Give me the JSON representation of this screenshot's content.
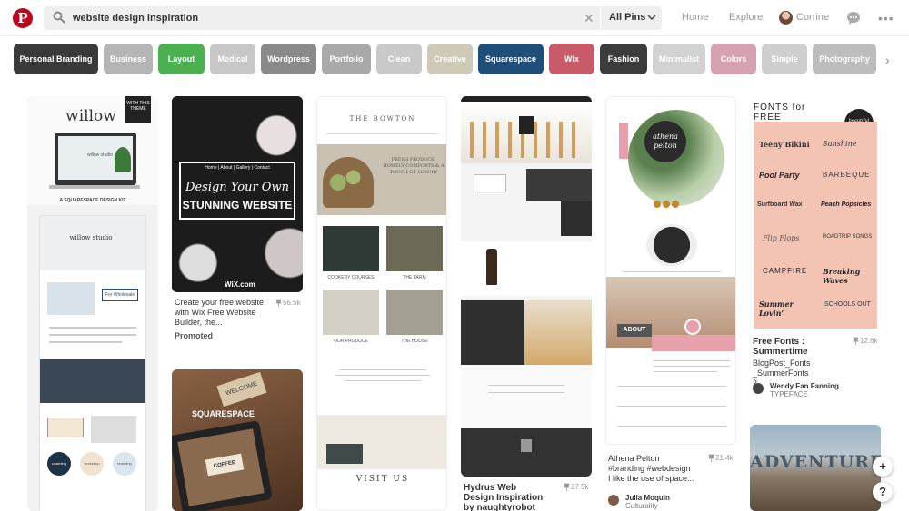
{
  "header": {
    "logo": "P",
    "search_value": "website design inspiration",
    "scope": "All Pins",
    "nav_home": "Home",
    "nav_explore": "Explore",
    "user_name": "Corrine"
  },
  "guides": [
    {
      "label": "Personal Branding",
      "color": "#3a3a3a"
    },
    {
      "label": "Business",
      "color": "#b5b5b5"
    },
    {
      "label": "Layout",
      "color": "#4caf50"
    },
    {
      "label": "Medical",
      "color": "#c7c7c7"
    },
    {
      "label": "Wordpress",
      "color": "#8a8a8a"
    },
    {
      "label": "Portfolio",
      "color": "#a9a9a9"
    },
    {
      "label": "Clean",
      "color": "#c9c9c9"
    },
    {
      "label": "Creative",
      "color": "#cfc9b8"
    },
    {
      "label": "Squarespace",
      "color": "#1f4e79"
    },
    {
      "label": "Wix",
      "color": "#c75b6a"
    },
    {
      "label": "Fashion",
      "color": "#3c3c3c"
    },
    {
      "label": "Minimalist",
      "color": "#d2d2d2"
    },
    {
      "label": "Colors",
      "color": "#d6a2b0"
    },
    {
      "label": "Simple",
      "color": "#cfcfcf"
    },
    {
      "label": "Photography",
      "color": "#bdbdbd"
    }
  ],
  "pins": {
    "willow": {
      "brand": "willow",
      "badge": "WITH THIS THEME",
      "studio": "willow studio",
      "kit": "A SQUARESPACE DESIGN KIT",
      "inner_title": "willow studio",
      "tag": "For Wholesale",
      "circles": [
        "coaching",
        "workshop",
        "branding"
      ]
    },
    "wix": {
      "title_line1": "Design Your Own",
      "title_line2": "STUNNING WEBSITE",
      "nav": "Home | About | Gallery | Contact",
      "logo": "WiX.com",
      "caption": "Create your free website with Wix Free Website Builder, the...",
      "saves": "56.5k",
      "promoted": "Promoted"
    },
    "squarespace_mock": {
      "sticker": "WELCOME",
      "logo": "SQUARESPACE",
      "card_title": "COFFEE"
    },
    "bowton": {
      "title": "THE BOWTON",
      "tagline": "FRESH PRODUCE, HOMELY COMFORTS & A TOUCH OF LUXURY",
      "labels": [
        "COOKERY COURSES",
        "THE FARM",
        "OUR PRODUCE",
        "THE HOUSE"
      ],
      "footer": "VISIT US"
    },
    "hydrus": {
      "caption": "Hydrus Web Design Inspiration by naughtyrobot",
      "saves": "27.5k"
    },
    "athena": {
      "brand": "athena pelton",
      "about": "ABOUT",
      "caption_title": "Athena Pelton",
      "caption_tags": "#branding #webdesign",
      "caption_text": "I like the use of space...",
      "saves": "21.4k",
      "user": "Julia Moquin",
      "board": "Culturality"
    },
    "fonts": {
      "header": "FONTS for FREE",
      "seal": "beautiful summertime",
      "samples": [
        "Teeny Bikini",
        "Sunshine",
        "Pool Party",
        "BARBEQUE",
        "Surfboard Wax",
        "Peach Popsicles",
        "Flip Flops",
        "ROADTRIP SONGS",
        "CAMPFIRE",
        "Breaking Waves",
        "Summer Lovin'",
        "SCHOOLS OUT"
      ],
      "caption_title": "Free Fonts : Summertime",
      "caption_text": "BlogPost_Fonts_SummerFonts2",
      "saves": "12.6k",
      "user": "Wendy Fan Fanning",
      "board": "TYPEFACE"
    },
    "adventure": {
      "title": "ADVENTURE"
    }
  },
  "floating": {
    "add": "+",
    "help": "?"
  },
  "colors": {
    "brand": "#bd081c",
    "accent_pink": "#e8a0ac"
  }
}
